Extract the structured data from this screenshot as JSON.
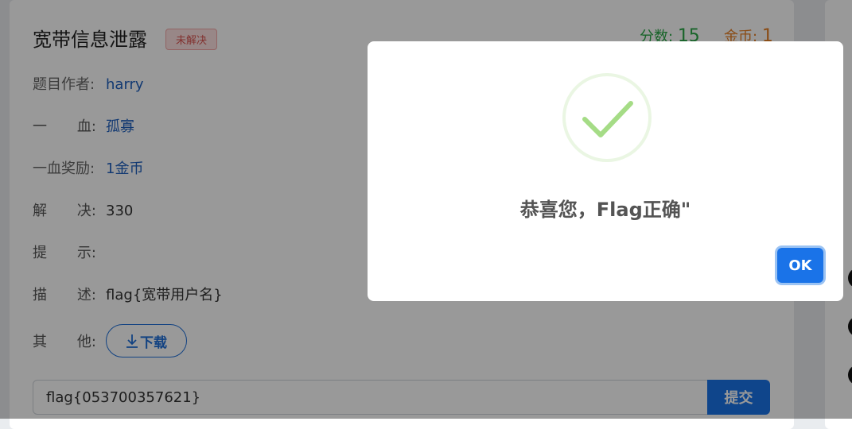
{
  "challenge": {
    "title": "宽带信息泄露",
    "status_badge": "未解决",
    "score_label": "分数:",
    "score_value": "15",
    "coin_label": "金币:",
    "coin_value": "1",
    "author_label": "题目作者:",
    "author_value": "harry",
    "first_blood_label_a": "一",
    "first_blood_label_b": "血:",
    "first_blood_value": "孤寡",
    "first_blood_reward_label": "一血奖励:",
    "first_blood_reward_value": "1金币",
    "solves_label_a": "解",
    "solves_label_b": "决:",
    "solves_value": "330",
    "hint_label_a": "提",
    "hint_label_b": "示:",
    "hint_value": "",
    "desc_label_a": "描",
    "desc_label_b": "述:",
    "desc_value": "flag{宽带用户名}",
    "other_label_a": "其",
    "other_label_b": "他:",
    "download_label": "下载",
    "flag_input_value": "flag{053700357621}",
    "submit_label": "提交"
  },
  "modal": {
    "message": "恭喜您，Flag正确\"",
    "ok_label": "OK"
  },
  "colors": {
    "accent": "#1a73e8",
    "success": "#28a745",
    "coin": "#e67e22",
    "check": "#a5dc86"
  },
  "icons": [
    "download-icon",
    "check-icon"
  ]
}
